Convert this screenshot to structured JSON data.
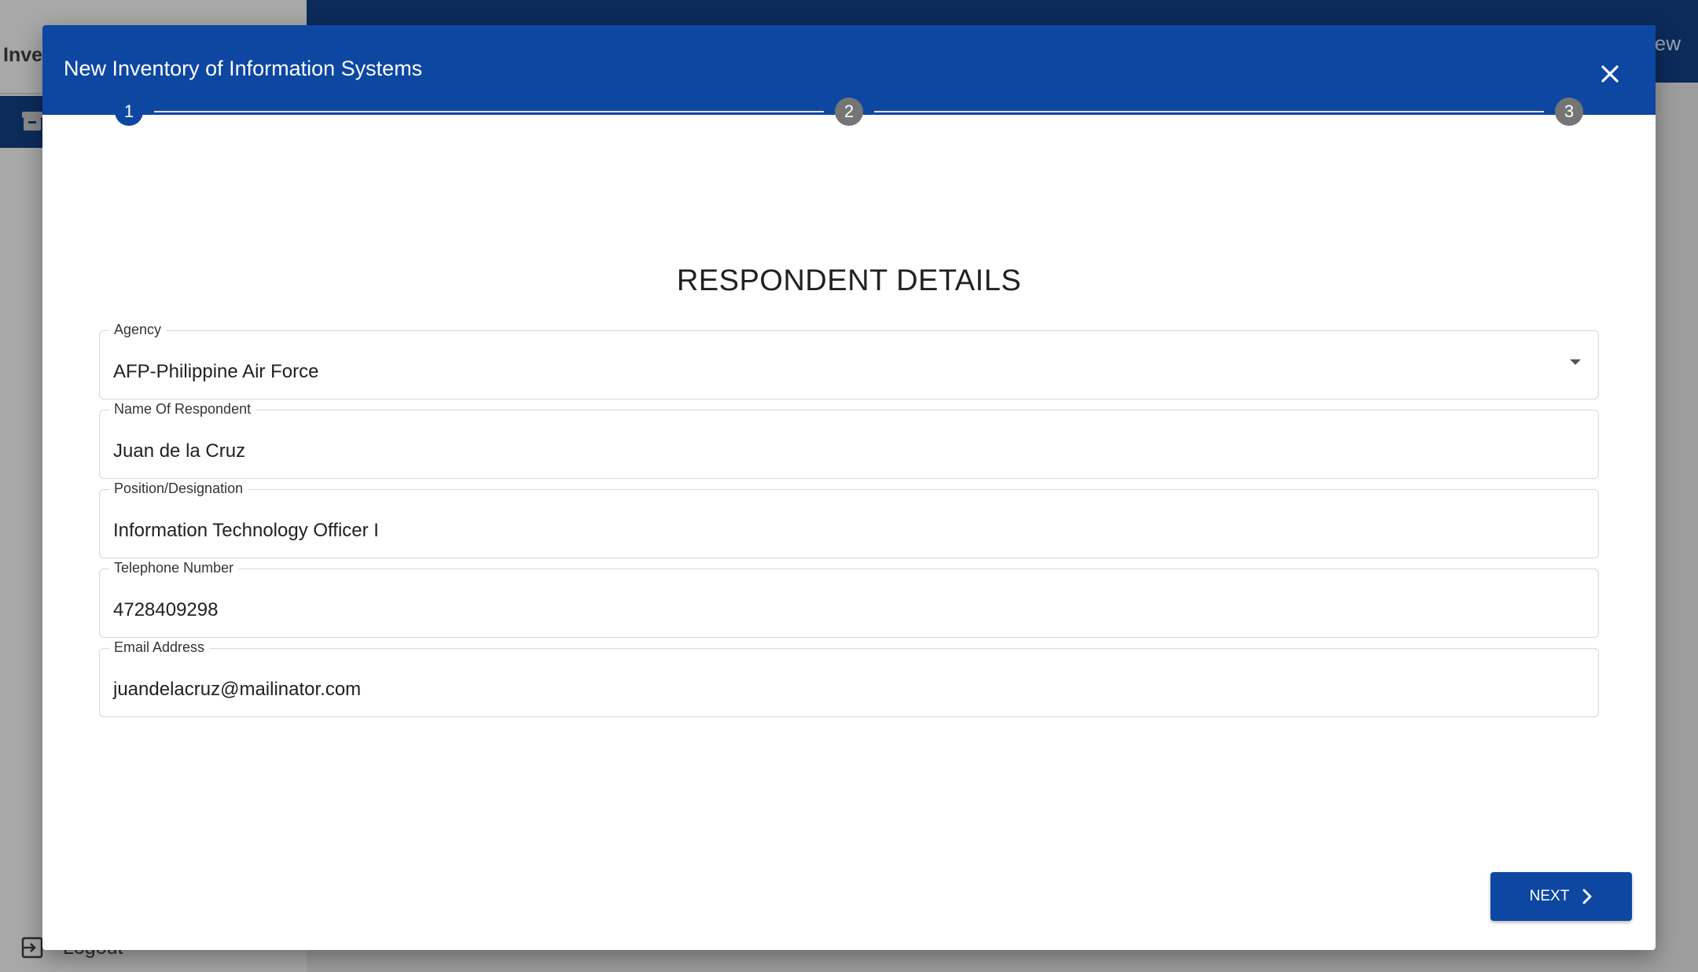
{
  "background": {
    "app_title": "Inve",
    "topbar_text": "ew",
    "logout_label": "Logout"
  },
  "dialog": {
    "title": "New Inventory of Information Systems",
    "steps": [
      "1",
      "2",
      "3"
    ],
    "active_step": 1,
    "section_title": "RESPONDENT DETAILS",
    "fields": {
      "agency": {
        "label": "Agency",
        "value": "AFP-Philippine Air Force"
      },
      "name": {
        "label": "Name Of Respondent",
        "value": "Juan de la Cruz"
      },
      "position": {
        "label": "Position/Designation",
        "value": "Information Technology Officer I"
      },
      "telephone": {
        "label": "Telephone Number",
        "value": "4728409298"
      },
      "email": {
        "label": "Email Address",
        "value": "juandelacruz@mailinator.com"
      }
    },
    "next_label": "NEXT"
  },
  "colors": {
    "primary": "#0d47a1",
    "inactive_step": "#757575",
    "overlay_bg": "#9e9e9e"
  },
  "icons": [
    "close-icon",
    "chevron-right-icon",
    "chevron-down-icon",
    "archive-icon",
    "logout-icon"
  ]
}
